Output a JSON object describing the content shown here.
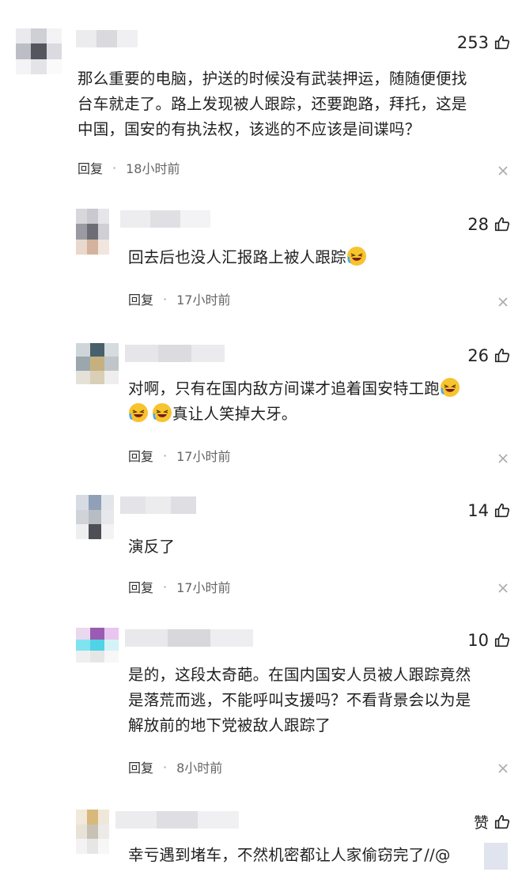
{
  "comments": [
    {
      "likes": "253",
      "text_lines": [
        "那么重要的电脑，护送的时候没有武装押运，随随便便找",
        "台车就走了。路上发现被人跟踪，还要跑路，拜托，这是",
        "中国，国安的有执法权，该逃的不应该是间谍吗？"
      ],
      "reply": "回复",
      "time": "18小时前"
    },
    {
      "likes": "28",
      "text_lines": [
        "回去后也没人汇报路上被人跟踪"
      ],
      "reply": "回复",
      "time": "17小时前"
    },
    {
      "likes": "26",
      "text_lines": [
        "对啊，只有在国内敌方间谍才追着国安特工跑",
        "真让人笑掉大牙。"
      ],
      "reply": "回复",
      "time": "17小时前"
    },
    {
      "likes": "14",
      "text_lines": [
        "演反了"
      ],
      "reply": "回复",
      "time": "17小时前"
    },
    {
      "likes": "10",
      "text_lines": [
        "是的，这段太奇葩。在国内国安人员被人跟踪竟然",
        "是落荒而逃，不能呼叫支援吗？不看背景会以为是",
        "解放前的地下党被敌人跟踪了"
      ],
      "reply": "回复",
      "time": "8小时前"
    },
    {
      "likes": "赞",
      "text_lines": [
        "幸亏遇到堵车，不然机密都让人家偷窃完了//@"
      ]
    }
  ],
  "icons": {
    "like": "thumbs-up-icon",
    "close": "close-icon",
    "emoji": "laughing-crying-emoji"
  },
  "colors": {
    "text": "#1f1f1f",
    "meta": "#666666",
    "emoji_face": "#f7c32e"
  }
}
